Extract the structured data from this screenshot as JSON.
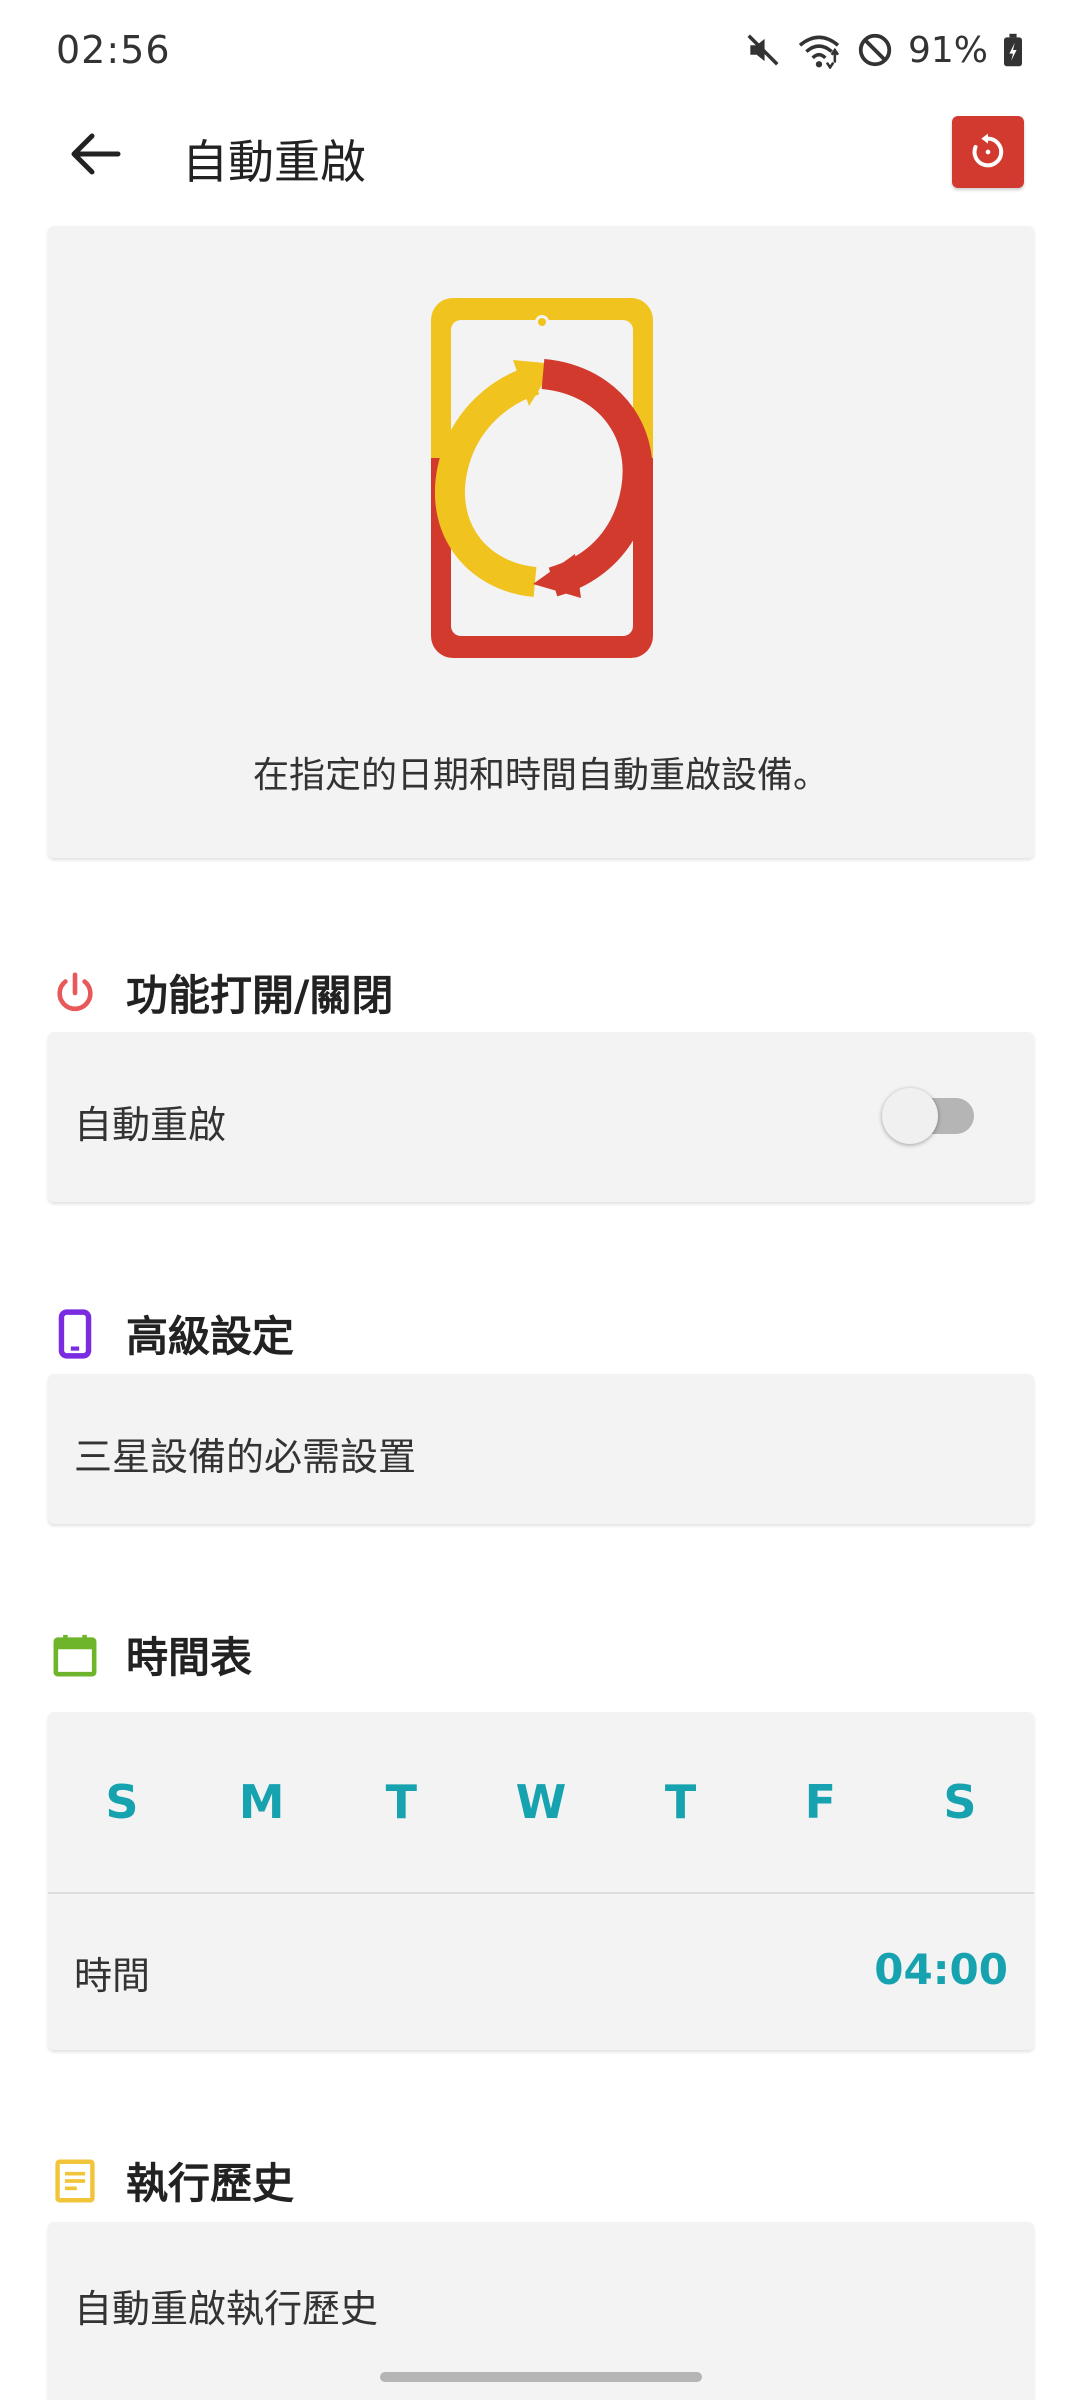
{
  "status_bar": {
    "time": "02:56",
    "battery": "91%",
    "icons": [
      "mute-icon",
      "wifi-icon",
      "do-not-disturb-icon",
      "battery-charging-icon"
    ]
  },
  "app_bar": {
    "title": "自動重啟",
    "back_icon": "arrow-left-icon",
    "action_icon": "restart-icon"
  },
  "hero": {
    "description": "在指定的日期和時間自動重啟設備。"
  },
  "sections": {
    "toggle": {
      "title": "功能打開/關閉",
      "icon": "power-icon",
      "row_label": "自動重啟",
      "enabled": false
    },
    "advanced": {
      "title": "高級設定",
      "icon": "phone-icon",
      "row_label": "三星設備的必需設置"
    },
    "schedule": {
      "title": "時間表",
      "icon": "calendar-icon",
      "days": [
        "S",
        "M",
        "T",
        "W",
        "T",
        "F",
        "S"
      ],
      "time_label": "時間",
      "time_value": "04:00"
    },
    "history": {
      "title": "執行歷史",
      "icon": "document-icon",
      "row_label": "自動重啟執行歷史"
    }
  },
  "colors": {
    "accent_teal": "#17a2b0",
    "restart_red": "#d33a2f",
    "power_red": "#e8575a",
    "phone_purple": "#7b2be0",
    "calendar_green": "#6fb52c",
    "document_yellow": "#f2c43a"
  }
}
